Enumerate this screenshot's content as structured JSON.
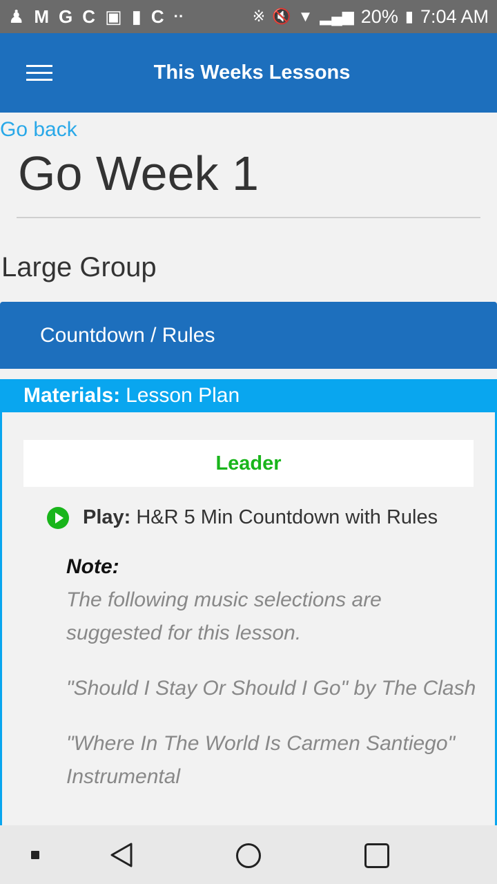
{
  "status_bar": {
    "left_icons": [
      "person-icon",
      "gmail-icon",
      "google-icon",
      "c-app-icon",
      "image-icon",
      "sd-card-icon",
      "c-app-icon",
      "dots-icon"
    ],
    "battery_percent": "20%",
    "time": "7:04 AM"
  },
  "appbar": {
    "title": "This Weeks Lessons",
    "menu_icon": "hamburger-menu-icon"
  },
  "content": {
    "go_back": "Go back",
    "week_title": "Go Week 1",
    "section_title": "Large Group",
    "accordion_label": "Countdown / Rules",
    "materials_label": "Materials:",
    "materials_value": "Lesson Plan",
    "leader_label": "Leader",
    "play_label": "Play:",
    "play_value": "H&R 5 Min Countdown with Rules",
    "note_label": "Note:",
    "note_paragraphs": [
      "The following music selections are suggested for this lesson.",
      "\"Should I Stay Or Should I Go\" by The Clash",
      "\"Where In The World Is Carmen Santiego\" Instrumental"
    ]
  },
  "colors": {
    "appbar": "#1d6fbd",
    "link": "#29a8e8",
    "materials": "#09a6ef",
    "leader": "#19b51b"
  }
}
